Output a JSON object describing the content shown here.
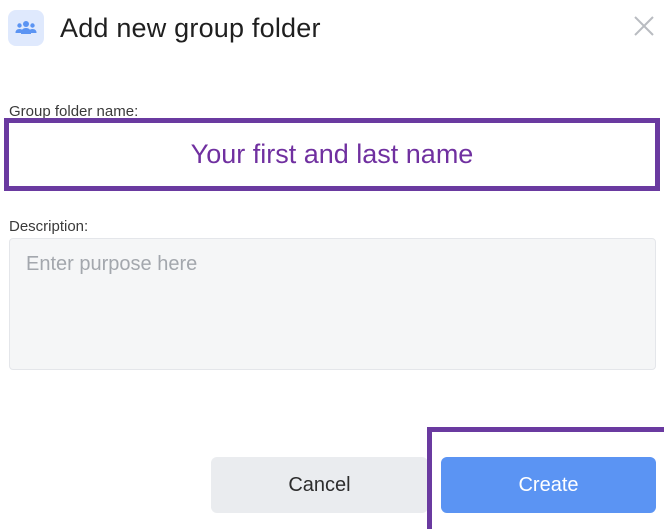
{
  "dialog": {
    "title": "Add new group folder",
    "header_icon": "users-group-icon",
    "close_icon": "close-icon"
  },
  "form": {
    "name_label": "Group folder name:",
    "name_value": "Your first and last name",
    "description_label": "Description:",
    "description_placeholder": "Enter purpose here",
    "description_value": ""
  },
  "buttons": {
    "cancel_label": "Cancel",
    "create_label": "Create"
  },
  "colors": {
    "accent_blue": "#5b94f3",
    "highlight_purple": "#6a3aa0",
    "name_text": "#7030a0",
    "icon_bg": "#dfe9fd"
  }
}
